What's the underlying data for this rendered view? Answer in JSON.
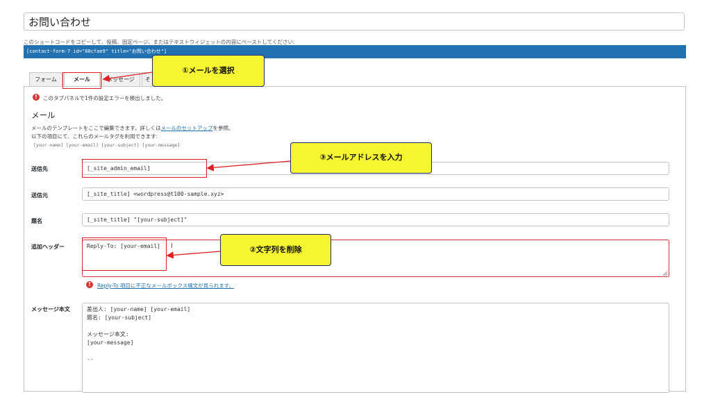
{
  "form_title": "お問い合わせ",
  "shortcode_hint": "このショートコードをコピーして、投稿、固定ページ、またはテキストウィジェットの内容にペーストしてください:",
  "shortcode": "[contact-form-7 id=\"08cfae9\" title=\"お問い合わせ\"]",
  "tabs": [
    {
      "label": "フォーム",
      "active": false
    },
    {
      "label": "メール",
      "active": true
    },
    {
      "label": "メッセージ",
      "active": false
    },
    {
      "label": "そ",
      "active": false
    }
  ],
  "panel": {
    "error_notice": "このタブパネルで1件の設定エラーを検出しました。",
    "heading": "メール",
    "desc_prefix": "メールのテンプレートをここで編集できます。詳しくは",
    "desc_link": "メールのセットアップ",
    "desc_suffix": "を参照。",
    "desc_line2": "以下の項目にて、これらのメールタグを利用できます:",
    "mail_tags": "[your-name] [your-email] [your-subject] [your-message]"
  },
  "fields": {
    "to": {
      "label": "送信先",
      "value": "[_site_admin_email]"
    },
    "from": {
      "label": "送信元",
      "value": "[_site_title] <wordpress@t100-sample.xyz>"
    },
    "subject": {
      "label": "題名",
      "value": "[_site_title] \"[your-subject]\""
    },
    "headers": {
      "label": "追加ヘッダー",
      "value": "Reply-To: [your-email]",
      "error_link": "Reply-To 項目に不正なメールボックス構文が見られます。"
    },
    "body": {
      "label": "メッセージ本文",
      "lines": [
        "差出人: [your-name] [your-email]",
        "題名: [your-subject]",
        "",
        "メッセージ本文:",
        "[your-message]",
        "",
        "--"
      ]
    }
  },
  "annotations": {
    "step1": "①メールを選択",
    "step2": "②文字列を削除",
    "step3": "③メールアドレスを入力"
  },
  "colors": {
    "shortcode_bar": "#2271b1",
    "error_red": "#d63638",
    "annotation_red": "#e02020",
    "callout_fill": "#f6f532",
    "callout_border": "#1c2a7a"
  }
}
